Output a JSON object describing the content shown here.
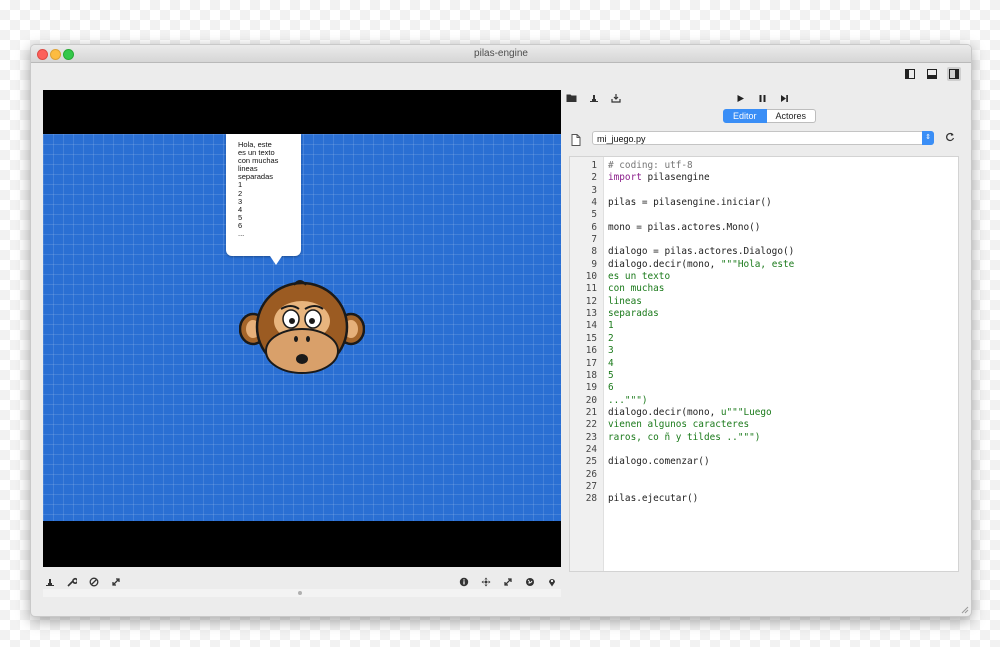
{
  "window": {
    "title": "pilas-engine"
  },
  "layout_buttons": [
    {
      "icon": "layout-left-panel-icon",
      "active": false
    },
    {
      "icon": "layout-bottom-panel-icon",
      "active": false
    },
    {
      "icon": "layout-right-panel-icon",
      "active": true
    }
  ],
  "scene": {
    "bubble_text": "Hola, este\nes un texto\ncon muchas\nlineas\nseparadas\n1\n2\n3\n4\n5\n6\n..."
  },
  "canvas_tools_left": [
    "actors-tool-icon",
    "wrench-icon",
    "no-entry-icon",
    "expand-icon"
  ],
  "canvas_tools_right": [
    "info-icon",
    "move-icon",
    "resize-icon",
    "globe-icon",
    "location-pin-icon"
  ],
  "toolbar": {
    "left_icons": [
      "open-folder-icon",
      "actors-icon",
      "export-icon"
    ],
    "play_icon": "play-icon",
    "pause_icon": "pause-icon",
    "step_icon": "step-forward-icon"
  },
  "tabs": [
    {
      "label": "Editor",
      "active": true
    },
    {
      "label": "Actores",
      "active": false
    }
  ],
  "file_selector": {
    "value": "mi_juego.py"
  },
  "code_lines": [
    {
      "n": "1",
      "text": "# coding: utf-8",
      "kind": "comment"
    },
    {
      "n": "2",
      "text": "import pilasengine",
      "kind": "import"
    },
    {
      "n": "3",
      "text": "",
      "kind": "plain"
    },
    {
      "n": "4",
      "text": "pilas = pilasengine.iniciar()",
      "kind": "plain"
    },
    {
      "n": "5",
      "text": "",
      "kind": "plain"
    },
    {
      "n": "6",
      "text": "mono = pilas.actores.Mono()",
      "kind": "plain"
    },
    {
      "n": "7",
      "text": "",
      "kind": "plain"
    },
    {
      "n": "8",
      "text": "dialogo = pilas.actores.Dialogo()",
      "kind": "plain"
    },
    {
      "n": "9",
      "text": "dialogo.decir(mono, \"\"\"Hola, este",
      "kind": "mixed1"
    },
    {
      "n": "10",
      "text": "es un texto",
      "kind": "string"
    },
    {
      "n": "11",
      "text": "con muchas",
      "kind": "string"
    },
    {
      "n": "12",
      "text": "lineas",
      "kind": "string"
    },
    {
      "n": "13",
      "text": "separadas",
      "kind": "string"
    },
    {
      "n": "14",
      "text": "1",
      "kind": "string"
    },
    {
      "n": "15",
      "text": "2",
      "kind": "string"
    },
    {
      "n": "16",
      "text": "3",
      "kind": "string"
    },
    {
      "n": "17",
      "text": "4",
      "kind": "string"
    },
    {
      "n": "18",
      "text": "5",
      "kind": "string"
    },
    {
      "n": "19",
      "text": "6",
      "kind": "string"
    },
    {
      "n": "20",
      "text": "...\"\"\")",
      "kind": "string"
    },
    {
      "n": "21",
      "text": "dialogo.decir(mono, u\"\"\"Luego",
      "kind": "mixed2"
    },
    {
      "n": "22",
      "text": "vienen algunos caracteres",
      "kind": "string"
    },
    {
      "n": "23",
      "text": "raros, co ñ y tildes ..\"\"\")",
      "kind": "string"
    },
    {
      "n": "24",
      "text": "",
      "kind": "plain"
    },
    {
      "n": "25",
      "text": "dialogo.comenzar()",
      "kind": "plain"
    },
    {
      "n": "26",
      "text": "",
      "kind": "plain"
    },
    {
      "n": "27",
      "text": "",
      "kind": "plain"
    },
    {
      "n": "28",
      "text": "pilas.ejecutar()",
      "kind": "plain"
    }
  ],
  "colors": {
    "scene_blue": "#2a6fd3",
    "accent_blue": "#3a8ef6",
    "comment": "#777777",
    "keyword": "#8a1d8a",
    "string": "#1b7a1b"
  }
}
